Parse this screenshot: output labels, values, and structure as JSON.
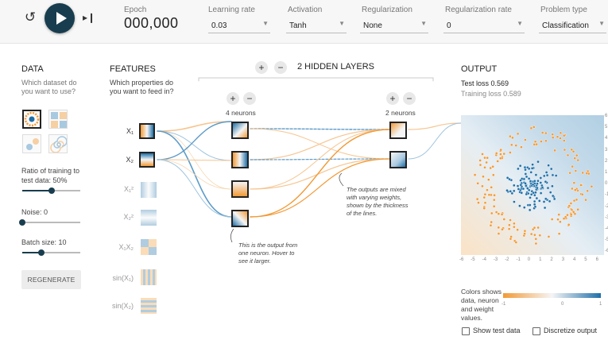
{
  "toolbar": {
    "reset_icon": "↺",
    "play_icon": "play-icon",
    "step_icon": "▸❙",
    "epoch_label": "Epoch",
    "epoch_value": "000,000",
    "learning_rate": {
      "label": "Learning rate",
      "value": "0.03"
    },
    "activation": {
      "label": "Activation",
      "value": "Tanh"
    },
    "regularization": {
      "label": "Regularization",
      "value": "None"
    },
    "regularization_rate": {
      "label": "Regularization rate",
      "value": "0"
    },
    "problem_type": {
      "label": "Problem type",
      "value": "Classification"
    }
  },
  "data_panel": {
    "title": "DATA",
    "subtitle": "Which dataset do you want to use?",
    "ratio_label": "Ratio of training to test data:",
    "ratio_value": "50%",
    "ratio_level": 0.5,
    "noise_label": "Noise:",
    "noise_value": "0",
    "noise_level": 0,
    "batch_label": "Batch size:",
    "batch_value": "10",
    "batch_level": 0.33,
    "regenerate_label": "REGENERATE"
  },
  "features_panel": {
    "title": "FEATURES",
    "subtitle": "Which properties do you want to feed in?",
    "features": [
      {
        "label": "X₁",
        "active": true
      },
      {
        "label": "X₂",
        "active": true
      },
      {
        "label": "X₁²",
        "active": false
      },
      {
        "label": "X₂²",
        "active": false
      },
      {
        "label": "X₁X₂",
        "active": false
      },
      {
        "label": "sin(X₁)",
        "active": false
      },
      {
        "label": "sin(X₂)",
        "active": false
      }
    ]
  },
  "network": {
    "add_layer": "+",
    "remove_layer": "−",
    "hidden_title": "2 HIDDEN LAYERS",
    "layer1_count": "4 neurons",
    "layer2_count": "2 neurons",
    "add_neuron": "+",
    "remove_neuron": "−",
    "note_neuron": "This is the output from one neuron. Hover to see it larger.",
    "note_weights": "The outputs are mixed with varying weights, shown by the thickness of the lines."
  },
  "output_panel": {
    "title": "OUTPUT",
    "test_loss": "Test loss 0.569",
    "training_loss": "Training loss 0.589",
    "x_ticks": [
      "-6",
      "-5",
      "-4",
      "-3",
      "-2",
      "-1",
      "0",
      "1",
      "2",
      "3",
      "4",
      "5",
      "6"
    ],
    "y_ticks": [
      "6",
      "5",
      "4",
      "3",
      "2",
      "1",
      "0",
      "-1",
      "-2",
      "-3",
      "-4",
      "-5",
      "-6"
    ],
    "legend_text": "Colors shows data, neuron and weight values.",
    "legend_min": "-1",
    "legend_mid": "0",
    "legend_max": "1",
    "show_test_label": "Show test data",
    "discretize_label": "Discretize output"
  },
  "colors": {
    "orange": "#f29a36",
    "blue": "#1e6fa8",
    "dark": "#183d4e"
  }
}
